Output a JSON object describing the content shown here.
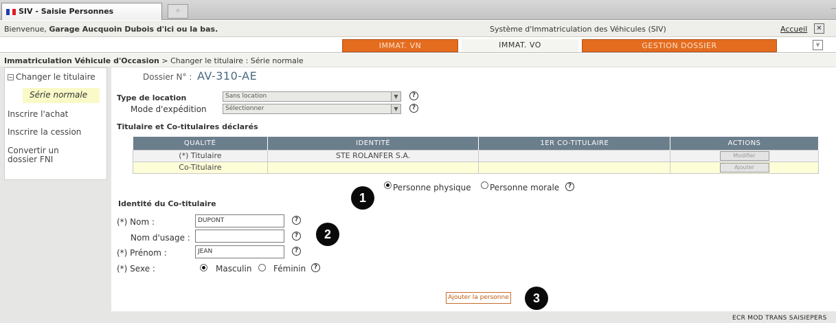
{
  "browser": {
    "tab_title": "SIV - Saisie Personnes",
    "new_tab_glyph": "✧",
    "scroll_glyph": "−",
    "flag_colors": [
      "#1f3fa8",
      "#ffffff",
      "#e01b24"
    ]
  },
  "header": {
    "welcome_prefix": "Bienvenue, ",
    "welcome_name": "Garage Aucquoin Dubois d'ici ou la bas.",
    "system_name": "Système d'Immatriculation des Véhicules (SIV)",
    "home_link": "Accueil",
    "close_glyph": "✕"
  },
  "nav": {
    "tabs": [
      {
        "label": "IMMAT. VN",
        "active": false
      },
      {
        "label": "IMMAT. VO",
        "active": true
      },
      {
        "label": "GESTION DOSSIER",
        "active": false
      }
    ],
    "collapse_glyph": "¥"
  },
  "breadcrumb": {
    "root": "Immatriculation Véhicule d'Occasion",
    "separator": " > ",
    "current": "Changer le titulaire : Série normale"
  },
  "sidebar": {
    "collapse_glyph": "−",
    "items": [
      {
        "label": "Changer le titulaire"
      },
      {
        "label": "Série normale"
      },
      {
        "label": "Inscrire l'achat"
      },
      {
        "label": "Inscrire la cession"
      },
      {
        "label": "Convertir un dossier FNI"
      }
    ]
  },
  "dossier": {
    "label": "Dossier N° :",
    "number": "AV-310-AE"
  },
  "location": {
    "type_label": "Type de location",
    "type_value": "Sans location",
    "mode_label": "Mode d'expédition",
    "mode_value": "Sélectionner"
  },
  "titulaires": {
    "section_title": "Titulaire et Co-titulaires déclarés",
    "columns": [
      "QUALITÉ",
      "IDENTITÉ",
      "1ER CO-TITULAIRE",
      "ACTIONS"
    ],
    "rows": [
      {
        "qualite": "(*) Titulaire",
        "identite": "STE ROLANFER S.A.",
        "cotitulaire": "",
        "action": "Modifier"
      },
      {
        "qualite": "Co-Titulaire",
        "identite": "",
        "cotitulaire": "",
        "action": "Ajouter"
      }
    ]
  },
  "person_type": {
    "physique": "Personne physique",
    "morale": "Personne morale",
    "selected": "physique"
  },
  "identity": {
    "section_title": "Identité du Co-titulaire",
    "nom_label": "(*) Nom :",
    "nom_value": "DUPONT",
    "usage_label": "Nom d'usage :",
    "usage_value": "",
    "prenom_label": "(*) Prénom :",
    "prenom_value": "JEAN",
    "sexe_label": "(*) Sexe :",
    "masculin": "Masculin",
    "feminin": "Féminin",
    "sexe_selected": "masculin"
  },
  "help_glyph": "?",
  "markers": [
    "1",
    "2",
    "3"
  ],
  "actions": {
    "add_person": "Ajouter la personne"
  },
  "footer": {
    "code": "ECR MOD TRANS SAISIEPERS"
  },
  "colors": {
    "accent_orange": "#e46c1f",
    "table_header": "#6b7e8c",
    "highlight_yellow": "#fafac8"
  }
}
